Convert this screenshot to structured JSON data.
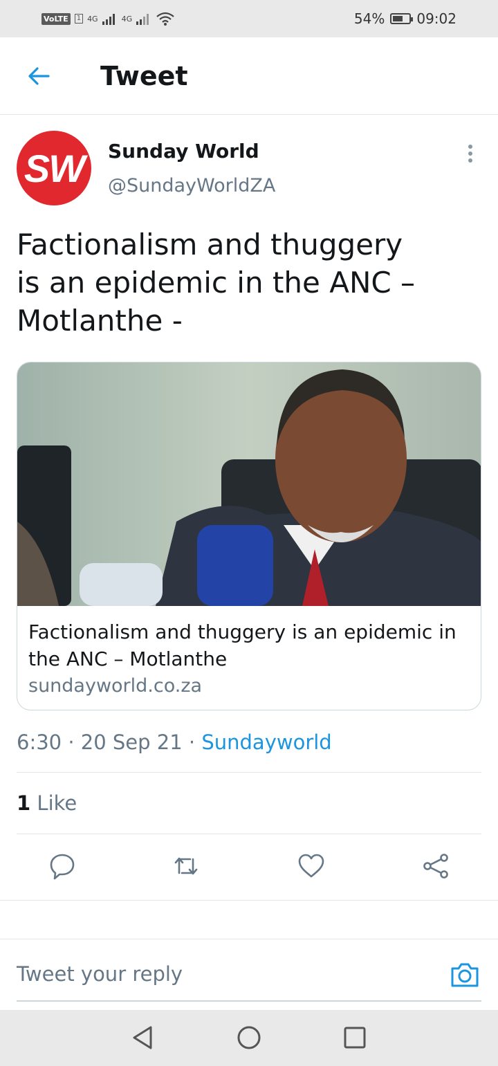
{
  "status_bar": {
    "volte": "VoLTE",
    "sim1": "1",
    "net1": "4G",
    "net2": "4G",
    "battery": "54%",
    "battery_level": 0.54,
    "time": "09:02"
  },
  "header": {
    "title": "Tweet",
    "back_icon": "back-arrow-icon"
  },
  "tweet": {
    "avatar_text": "SW",
    "avatar_color": "#e0282e",
    "author_name": "Sunday World",
    "author_handle": "@SundayWorldZA",
    "text": "Factionalism and thuggery\nis an epidemic in the ANC –\nMotlanthe -",
    "card": {
      "title": "Factionalism and thuggery is an epidemic in the ANC – Motlanthe",
      "domain": "sundayworld.co.za"
    },
    "time": "6:30",
    "date": "20 Sep 21",
    "sep": "·",
    "source": "Sundayworld",
    "likes_count": "1",
    "likes_label": "Like"
  },
  "actions": [
    "reply-icon",
    "retweet-icon",
    "like-icon",
    "share-icon"
  ],
  "reply_box": {
    "placeholder": "Tweet your reply"
  },
  "colors": {
    "accent": "#1b95e0",
    "text_secondary": "#657786",
    "text_primary": "#14171a"
  }
}
